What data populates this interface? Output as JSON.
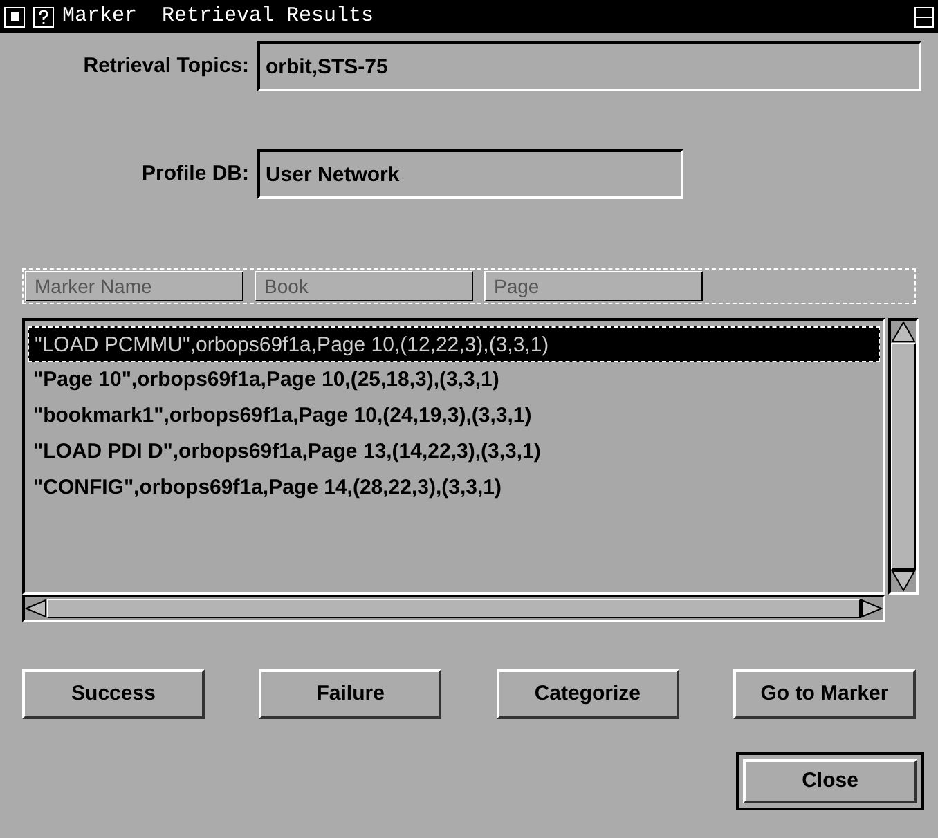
{
  "window": {
    "title": "Marker  Retrieval Results"
  },
  "fields": [
    {
      "label": "Retrieval Topics:",
      "value": "orbit,STS-75",
      "wide": true
    },
    {
      "label": "Profile DB:",
      "value": "User Network",
      "wide": false
    }
  ],
  "columns": [
    "Marker Name",
    "Book",
    "Page"
  ],
  "rows": [
    {
      "text": "\"LOAD PCMMU\",orbops69f1a,Page 10,(12,22,3),(3,3,1)",
      "selected": true
    },
    {
      "text": "\"Page 10\",orbops69f1a,Page 10,(25,18,3),(3,3,1)",
      "selected": false
    },
    {
      "text": "\"bookmark1\",orbops69f1a,Page 10,(24,19,3),(3,3,1)",
      "selected": false
    },
    {
      "text": "\"LOAD PDI D\",orbops69f1a,Page 13,(14,22,3),(3,3,1)",
      "selected": false
    },
    {
      "text": "\"CONFIG\",orbops69f1a,Page 14,(28,22,3),(3,3,1)",
      "selected": false
    }
  ],
  "buttons": [
    "Success",
    "Failure",
    "Categorize",
    "Go to Marker"
  ],
  "close_button": "Close"
}
